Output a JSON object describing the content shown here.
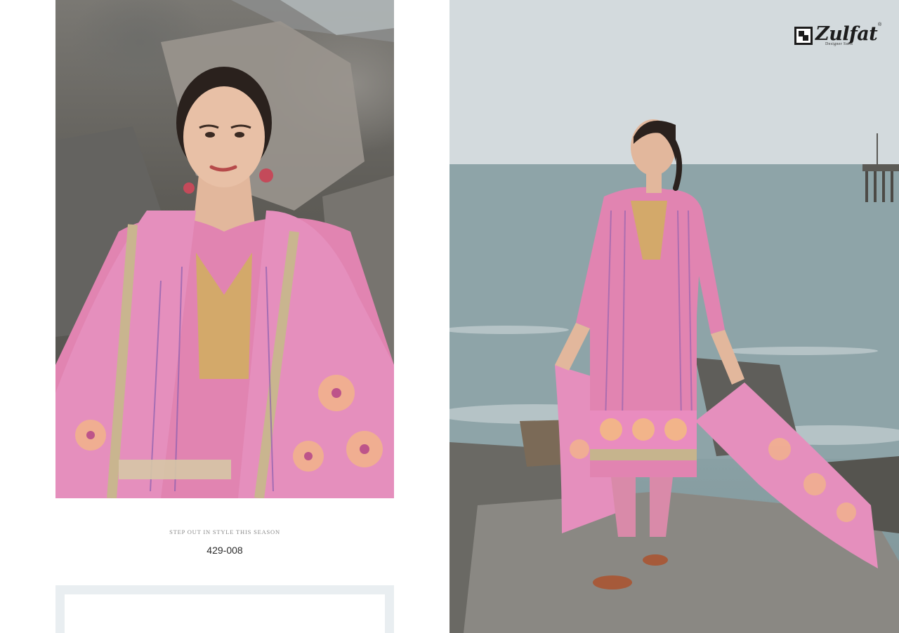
{
  "left_panel": {
    "tagline": "STEP OUT IN STYLE THIS SEASON",
    "design_code": "429-008"
  },
  "brand": {
    "name": "Zulfat",
    "subtitle": "Designer Suits",
    "registered_mark": "®"
  },
  "colors": {
    "suit_pink": "#e184b1",
    "dupatta_pink": "#e58fbd",
    "rock_grey": "#6b6a66",
    "sea": "#8aa1a5",
    "sky": "#d3dadd",
    "accent_text": "#8a8a8a"
  }
}
